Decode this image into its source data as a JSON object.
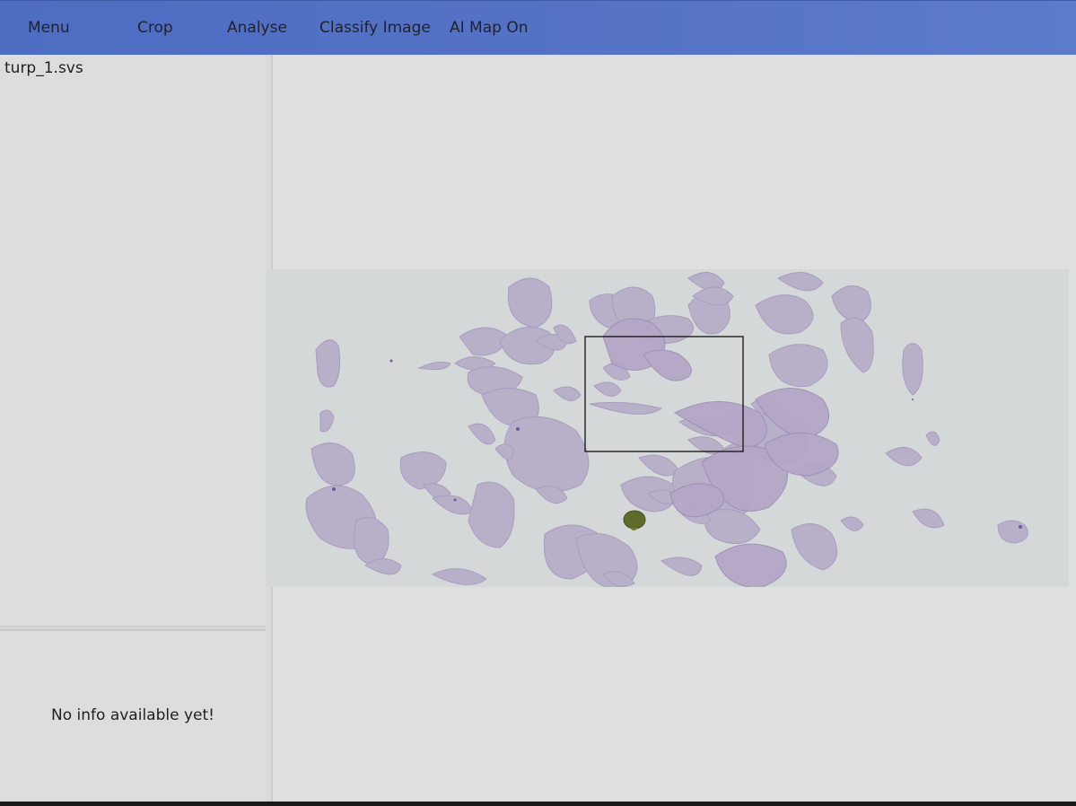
{
  "toolbar": {
    "menu": "Menu",
    "crop": "Crop",
    "analyse": "Analyse",
    "classify": "Classify Image",
    "ai_map": "AI Map On"
  },
  "sidebar": {
    "filename": "turp_1.svs",
    "info": "No info available yet!"
  },
  "colors": {
    "toolbar": "#5673c6",
    "tissue": "#b4a9c6",
    "tissue_dark": "#9e8fb8",
    "ink_mark": "#5c6a28"
  }
}
